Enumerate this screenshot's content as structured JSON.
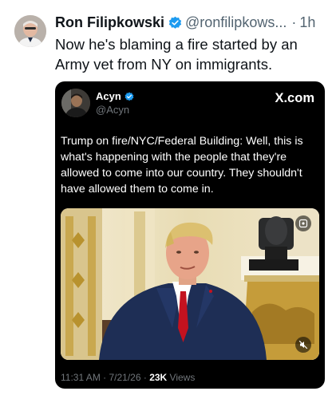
{
  "post": {
    "author_name": "Ron Filipkowski",
    "author_handle": "@ronfilipkows...",
    "separator": "·",
    "time": "1h",
    "text": "Now he's blaming a fire started by an Army vet from NY on immigrants.",
    "verified_badge_color": "#1d9bf0",
    "icons": {
      "verified": "verified-badge-icon"
    }
  },
  "embed": {
    "author_name": "Acyn",
    "author_handle": "@Acyn",
    "site_label": "X.com",
    "text": "Trump on fire/NYC/Federal Building: Well, this is what's happening with the people that they're allowed to come into our country. They shouldn't have allowed them to come in.",
    "footer": {
      "timestamp": "11:31 AM · 7/21/26 ·",
      "views_count": "23K",
      "views_label": "Views"
    },
    "colors": {
      "background": "#000000",
      "text": "#ffffff",
      "muted": "#71767b"
    },
    "media_icons": {
      "top_right": "gif-badge-icon",
      "bottom_right": "mute-icon"
    }
  }
}
